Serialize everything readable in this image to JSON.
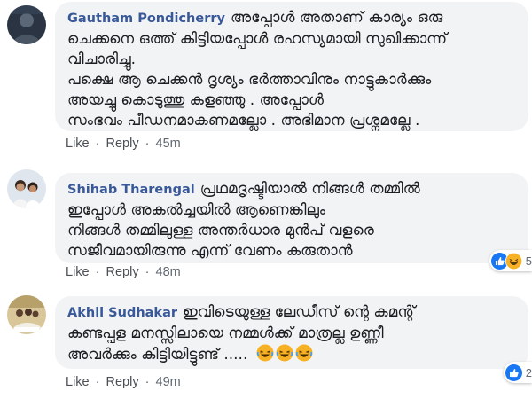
{
  "comments": [
    {
      "author": "Gautham Pondicherry",
      "text": "അപ്പോൾ അതാണ് കാര്യം ഒരു\nചെക്കനെ ഒത്ത് കിട്ടിയപ്പോൾ രഹസ്യമായി സുഖിക്കാന്ന്\nവിചാരിച്ചു.\nപക്ഷെ ആ ചെക്കൻ ദൃശ്യം ഭർത്താവിനും നാട്ടുകാർക്കും\nഅയച്ചു കൊടുത്തു കളഞ്ഞു . അപ്പോൾ\nസംഭവം പീഡനമാകണമല്ലോ . അഭിമാന പ്രശ്നമല്ലേ .",
      "like": "Like",
      "reply": "Reply",
      "separator": "·",
      "time": "45m",
      "avatar_icon": "profile-photo-dark"
    },
    {
      "author": "Shihab Tharengal",
      "text": "പ്രഥമദൃഷ്ടിയാൽ നിങ്ങൾ തമ്മിൽ\nഇപ്പോൾ അകൽച്ചയിൽ ആണെങ്കിലും\nനിങ്ങൾ തമ്മിലുള്ള അന്തർധാര മുൻപ് വളരെ\nസജീവമായിരുന്നു എന്ന് വേണം കരുതാൻ",
      "like": "Like",
      "reply": "Reply",
      "separator": "·",
      "time": "48m",
      "reactions_count": "5",
      "reaction_icons": [
        "like-reaction-icon",
        "haha-reaction-icon"
      ],
      "avatar_icon": "profile-photo-two-kids"
    },
    {
      "author": "Akhil Sudhakar",
      "text": "ഇവിടെയുള്ള ലേഡീസ് ന്റെ കമന്റ്\nകണ്ടപ്പള മനസ്സിലായെ നമ്മൾക്ക് മാത്രല്ല ഉണ്ണീ\nഅവർക്കും കിട്ടിയിട്ടുണ്ട് .....",
      "emoji_icons": [
        "laughing-emoji-icon",
        "laughing-emoji-icon",
        "laughing-emoji-icon"
      ],
      "like": "Like",
      "reply": "Reply",
      "separator": "·",
      "time": "49m",
      "reactions_count": "2",
      "reaction_icons": [
        "like-reaction-icon"
      ],
      "avatar_icon": "profile-photo-group"
    }
  ],
  "colors": {
    "author": "#385898",
    "bubble": "#f2f3f5",
    "like_blue": "#1877f2",
    "haha_yellow": "#f7b125"
  }
}
